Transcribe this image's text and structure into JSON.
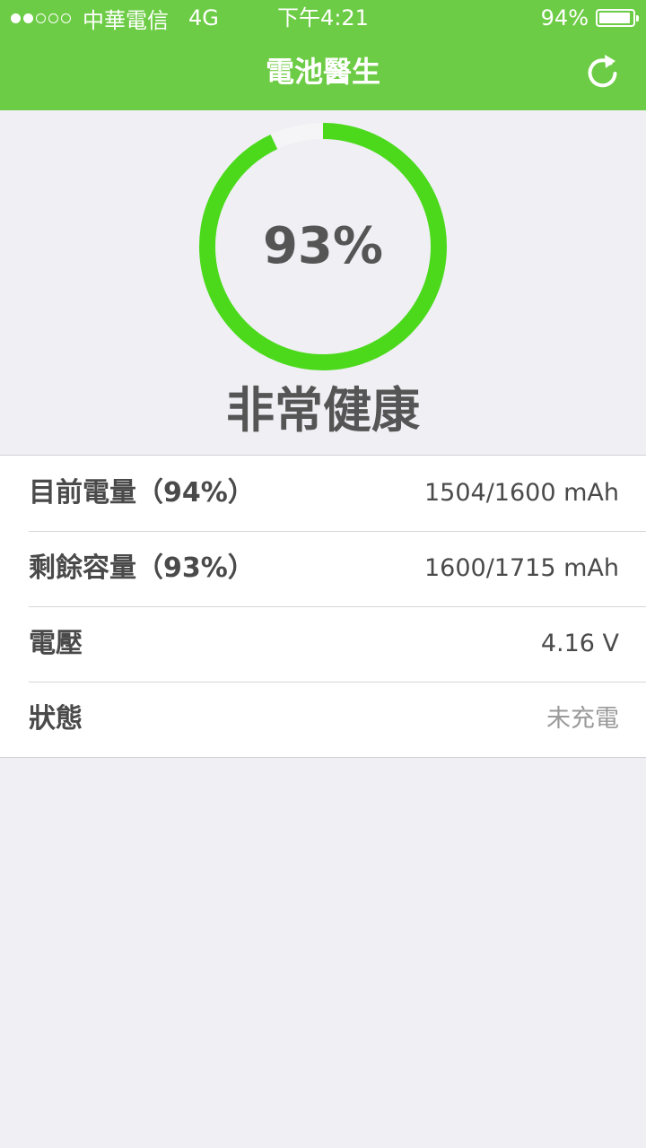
{
  "status_bar": {
    "signal_dots": [
      true,
      true,
      false,
      false,
      false
    ],
    "carrier": "中華電信",
    "network": "4G",
    "time": "下午4:21",
    "battery_percent": "94%",
    "battery_level": 0.94
  },
  "nav": {
    "title": "電池醫生",
    "refresh_icon": "refresh-icon"
  },
  "gauge": {
    "percent_label": "93%",
    "value": 0.93,
    "status": "非常健康",
    "ring_color": "#4cd91c",
    "track_color": "#f5f5f7"
  },
  "info_rows": [
    {
      "label": "目前電量（94%）",
      "value": "1504/1600 mAh"
    },
    {
      "label": "剩餘容量（93%）",
      "value": "1600/1715 mAh"
    },
    {
      "label": "電壓",
      "value": "4.16 V"
    },
    {
      "label": "狀態",
      "value": "未充電"
    }
  ],
  "colors": {
    "accent": "#6dcc45",
    "background": "#efeff4",
    "text": "#4a4a4a",
    "muted_text": "#9a9a9a"
  }
}
